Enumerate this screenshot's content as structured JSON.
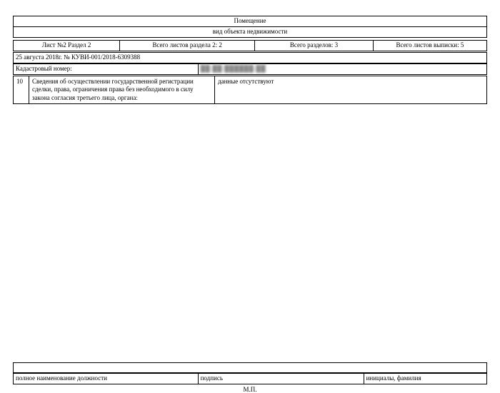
{
  "header": {
    "title": "Помещение",
    "subtitle": "вид объекта недвижимости"
  },
  "meta": {
    "sheet": "Лист №2  Раздел 2",
    "total_section_sheets": "Всего листов раздела 2: 2",
    "total_sections": "Всего разделов: 3",
    "total_extract_sheets": "Всего листов выписки: 5"
  },
  "info": {
    "date_ref": "25 августа 2018г. № КУВИ-001/2018-6309388",
    "cadastral_label": "Кадастровый номер:",
    "cadastral_value": "██:██:██████:██"
  },
  "rows": [
    {
      "num": "10",
      "desc": "Сведения об осуществлении государственной регистрации сделки, права, ограничения права без необходимого в силу закона согласия третьего лица, органа:",
      "value": "данные отсутствуют"
    }
  ],
  "signature": {
    "position": "полное наименование должности",
    "sign": "подпись",
    "name": "инициалы, фамилия",
    "stamp": "М.П."
  }
}
